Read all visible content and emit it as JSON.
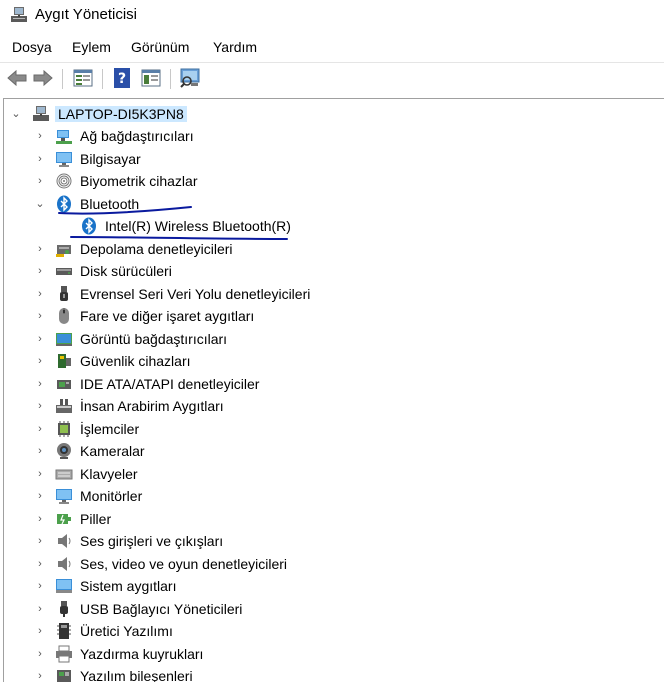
{
  "window": {
    "title": "Aygıt Yöneticisi"
  },
  "menu": [
    "Dosya",
    "Eylem",
    "Görünüm",
    "Yardım"
  ],
  "toolbar": [
    "back-icon",
    "forward-icon",
    "properties-icon",
    "help-icon",
    "details-icon",
    "scan-icon"
  ],
  "tree": {
    "root": "LAPTOP-DI5K3PN8",
    "categories": [
      {
        "label": "Ağ bağdaştırıcıları",
        "icon": "network-adapter-icon",
        "expanded": false
      },
      {
        "label": "Bilgisayar",
        "icon": "computer-icon",
        "expanded": false
      },
      {
        "label": "Biyometrik cihazlar",
        "icon": "fingerprint-icon",
        "expanded": false
      },
      {
        "label": "Bluetooth",
        "icon": "bluetooth-icon",
        "expanded": true,
        "children": [
          "Intel(R) Wireless Bluetooth(R)"
        ]
      },
      {
        "label": "Depolama denetleyicileri",
        "icon": "storage-controller-icon",
        "expanded": false
      },
      {
        "label": "Disk sürücüleri",
        "icon": "disk-drive-icon",
        "expanded": false
      },
      {
        "label": "Evrensel Seri Veri Yolu denetleyicileri",
        "icon": "usb-controller-icon",
        "expanded": false
      },
      {
        "label": "Fare ve diğer işaret aygıtları",
        "icon": "mouse-icon",
        "expanded": false
      },
      {
        "label": "Görüntü bağdaştırıcıları",
        "icon": "display-adapter-icon",
        "expanded": false
      },
      {
        "label": "Güvenlik cihazları",
        "icon": "security-device-icon",
        "expanded": false
      },
      {
        "label": "IDE ATA/ATAPI denetleyiciler",
        "icon": "ide-controller-icon",
        "expanded": false
      },
      {
        "label": "İnsan Arabirim Aygıtları",
        "icon": "hid-icon",
        "expanded": false
      },
      {
        "label": "İşlemciler",
        "icon": "processor-icon",
        "expanded": false
      },
      {
        "label": "Kameralar",
        "icon": "camera-icon",
        "expanded": false
      },
      {
        "label": "Klavyeler",
        "icon": "keyboard-icon",
        "expanded": false
      },
      {
        "label": "Monitörler",
        "icon": "monitor-icon",
        "expanded": false
      },
      {
        "label": "Piller",
        "icon": "battery-icon",
        "expanded": false
      },
      {
        "label": "Ses girişleri ve çıkışları",
        "icon": "audio-io-icon",
        "expanded": false
      },
      {
        "label": "Ses, video ve oyun denetleyicileri",
        "icon": "sound-controller-icon",
        "expanded": false
      },
      {
        "label": "Sistem aygıtları",
        "icon": "system-devices-icon",
        "expanded": false
      },
      {
        "label": "USB Bağlayıcı Yöneticileri",
        "icon": "usb-connector-icon",
        "expanded": false
      },
      {
        "label": "Üretici Yazılımı",
        "icon": "firmware-icon",
        "expanded": false
      },
      {
        "label": "Yazdırma kuyrukları",
        "icon": "print-queue-icon",
        "expanded": false
      },
      {
        "label": "Yazılım bileşenleri",
        "icon": "software-component-icon",
        "expanded": false
      }
    ]
  },
  "annotation_color": "#0a1a9e",
  "selection_color": "#cce8ff"
}
